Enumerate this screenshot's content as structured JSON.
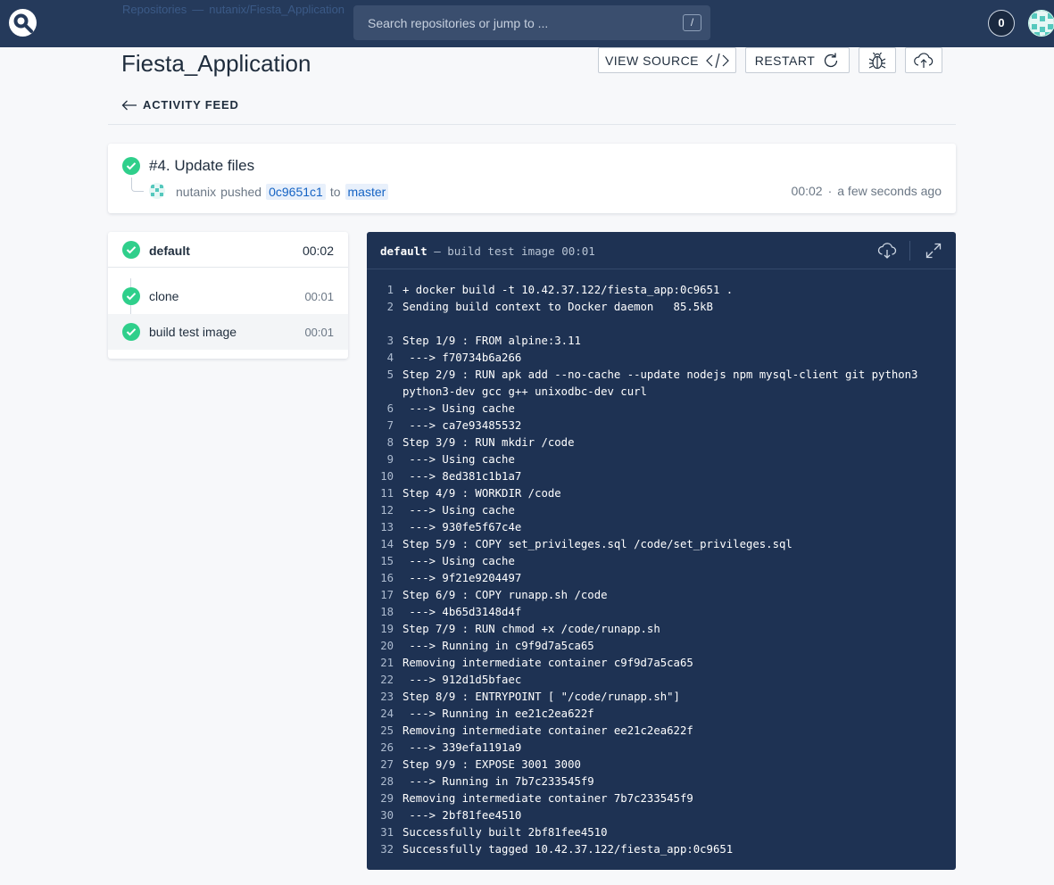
{
  "topbar": {
    "breadcrumb": [
      "Repositories",
      "nutanix/Fiesta_Application"
    ],
    "breadcrumb_sep": "—",
    "search_placeholder": "Search repositories or jump to ...",
    "search_shortcut": "/",
    "notification_count": "0"
  },
  "header": {
    "title": "Fiesta_Application",
    "view_source_label": "VIEW SOURCE",
    "restart_label": "RESTART",
    "back_label": "ACTIVITY FEED"
  },
  "build": {
    "title": "#4. Update files",
    "author": "nutanix",
    "action": "pushed",
    "commit": "0c9651c1",
    "to_text": "to",
    "branch": "master",
    "duration": "00:02",
    "time_sep": "·",
    "relative_time": "a few seconds ago"
  },
  "pipeline": {
    "name": "default",
    "duration": "00:02",
    "steps": [
      {
        "name": "clone",
        "duration": "00:01"
      },
      {
        "name": "build test image",
        "duration": "00:01"
      }
    ]
  },
  "console": {
    "step_name": "default",
    "subtitle": "— build test image 00:01",
    "lines": [
      {
        "n": "1",
        "t": "+ docker build -t 10.42.37.122/fiesta_app:0c9651 ."
      },
      {
        "n": "2",
        "t": "Sending build context to Docker daemon   85.5kB"
      },
      {
        "n": "3",
        "t": "Step 1/9 : FROM alpine:3.11"
      },
      {
        "n": "4",
        "t": " ---> f70734b6a266"
      },
      {
        "n": "5",
        "t": "Step 2/9 : RUN apk add --no-cache --update nodejs npm mysql-client git python3"
      },
      {
        "n": "",
        "t": "python3-dev gcc g++ unixodbc-dev curl"
      },
      {
        "n": "6",
        "t": " ---> Using cache"
      },
      {
        "n": "7",
        "t": " ---> ca7e93485532"
      },
      {
        "n": "8",
        "t": "Step 3/9 : RUN mkdir /code"
      },
      {
        "n": "9",
        "t": " ---> Using cache"
      },
      {
        "n": "10",
        "t": " ---> 8ed381c1b1a7"
      },
      {
        "n": "11",
        "t": "Step 4/9 : WORKDIR /code"
      },
      {
        "n": "12",
        "t": " ---> Using cache"
      },
      {
        "n": "13",
        "t": " ---> 930fe5f67c4e"
      },
      {
        "n": "14",
        "t": "Step 5/9 : COPY set_privileges.sql /code/set_privileges.sql"
      },
      {
        "n": "15",
        "t": " ---> Using cache"
      },
      {
        "n": "16",
        "t": " ---> 9f21e9204497"
      },
      {
        "n": "17",
        "t": "Step 6/9 : COPY runapp.sh /code"
      },
      {
        "n": "18",
        "t": " ---> 4b65d3148d4f"
      },
      {
        "n": "19",
        "t": "Step 7/9 : RUN chmod +x /code/runapp.sh"
      },
      {
        "n": "20",
        "t": " ---> Running in c9f9d7a5ca65"
      },
      {
        "n": "21",
        "t": "Removing intermediate container c9f9d7a5ca65"
      },
      {
        "n": "22",
        "t": " ---> 912d1d5bfaec"
      },
      {
        "n": "23",
        "t": "Step 8/9 : ENTRYPOINT [ \"/code/runapp.sh\"]"
      },
      {
        "n": "24",
        "t": " ---> Running in ee21c2ea622f"
      },
      {
        "n": "25",
        "t": "Removing intermediate container ee21c2ea622f"
      },
      {
        "n": "26",
        "t": " ---> 339efa1191a9"
      },
      {
        "n": "27",
        "t": "Step 9/9 : EXPOSE 3001 3000"
      },
      {
        "n": "28",
        "t": " ---> Running in 7b7c233545f9"
      },
      {
        "n": "29",
        "t": "Removing intermediate container 7b7c233545f9"
      },
      {
        "n": "30",
        "t": " ---> 2bf81fee4510"
      },
      {
        "n": "31",
        "t": "Successfully built 2bf81fee4510"
      },
      {
        "n": "32",
        "t": "Successfully tagged 10.42.37.122/fiesta_app:0c9651"
      }
    ]
  },
  "colors": {
    "topbar": "#253a5b",
    "console_bg": "#1e3253",
    "success": "#2fcf8b",
    "link": "#1563c4"
  },
  "icons": [
    "drone-logo-icon",
    "code-icon",
    "refresh-icon",
    "bug-icon",
    "cloud-upload-icon",
    "check-icon",
    "cloud-download-icon",
    "expand-icon",
    "arrow-left-icon"
  ]
}
